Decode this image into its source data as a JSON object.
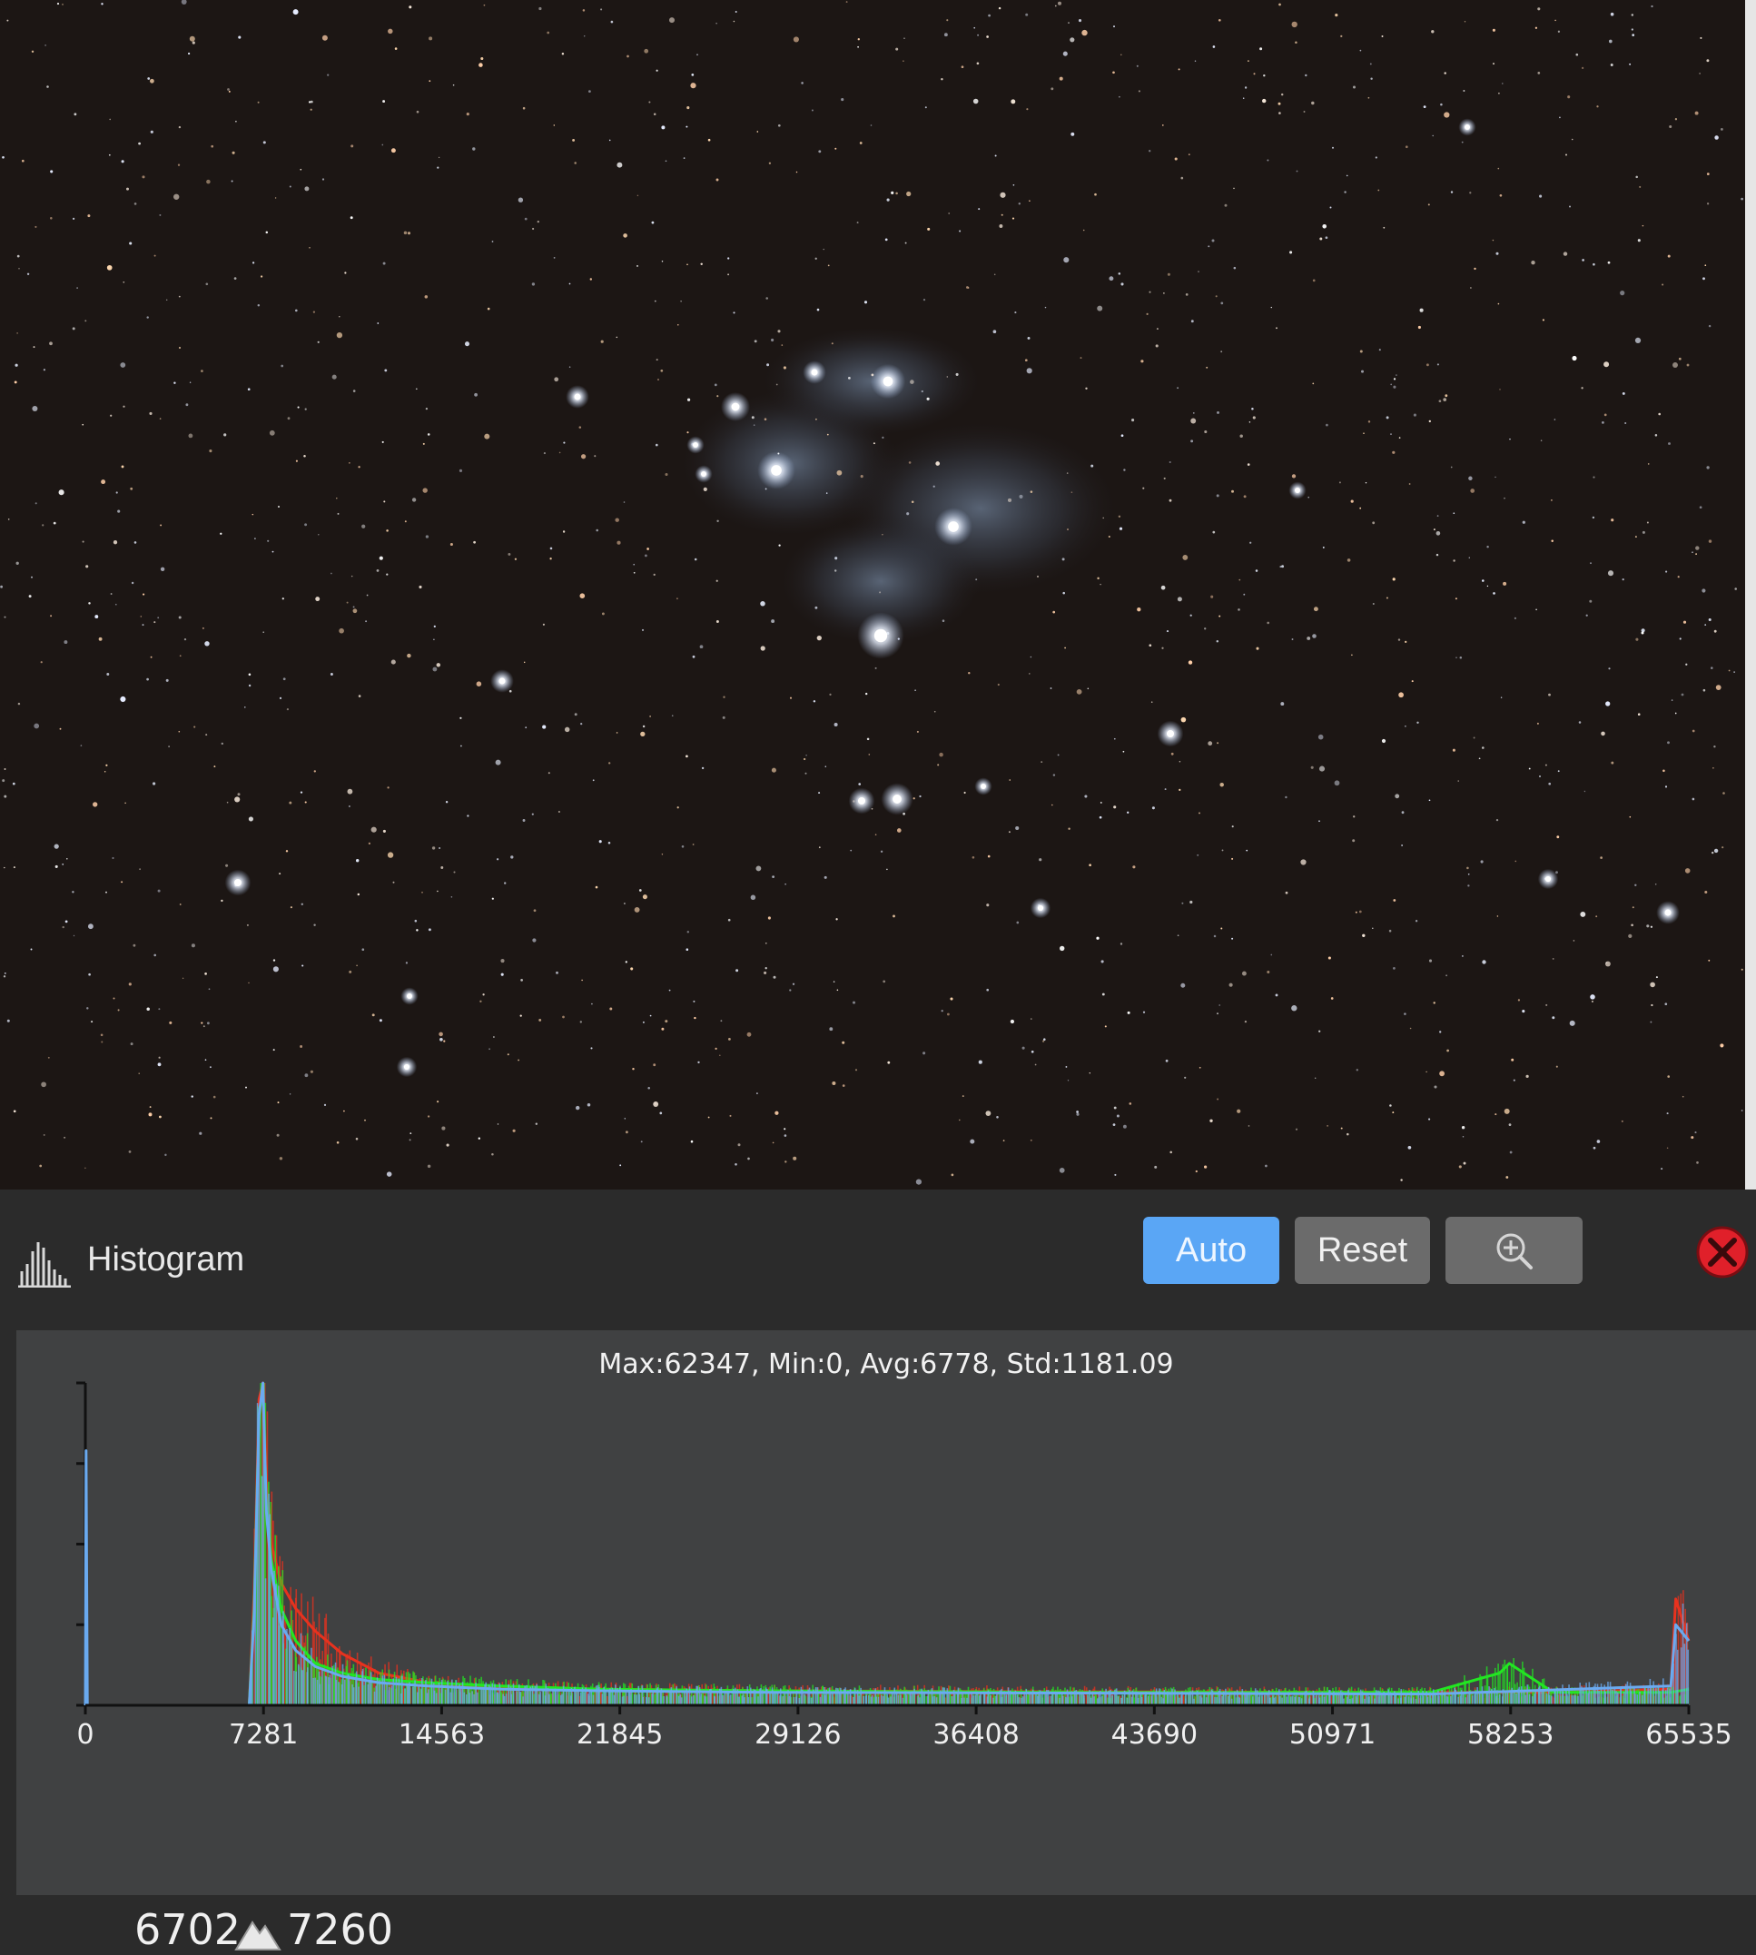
{
  "panel": {
    "title": "Histogram",
    "icon": "histogram-icon",
    "buttons": {
      "auto_label": "Auto",
      "reset_label": "Reset",
      "zoom_icon": "zoom-in-icon",
      "close_icon": "close-icon"
    },
    "colors": {
      "auto_active": "#5aa6f5",
      "button_inactive": "#6b6b6b",
      "close": "#e0202a",
      "red_channel": "#e8321e",
      "green_channel": "#22e622",
      "blue_channel": "#6aaaf0"
    }
  },
  "stats_text": "Max:62347, Min:0, Avg:6778, Std:1181.09",
  "range": {
    "low": "6702",
    "high": "7260",
    "icon": "mountain-icon"
  },
  "chart_data": {
    "type": "line",
    "x_ticks": [
      "0",
      "7281",
      "14563",
      "21845",
      "29126",
      "36408",
      "43690",
      "50971",
      "58253",
      "65535"
    ],
    "xlim": [
      0,
      65535
    ],
    "ylim": [
      0,
      1
    ],
    "grid": false,
    "series": [
      {
        "color": "#e8321e",
        "x": [
          0,
          6700,
          6900,
          7100,
          7260,
          7400,
          7600,
          8000,
          8600,
          9400,
          10500,
          12000,
          14000,
          17000,
          21000,
          28000,
          40000,
          55000,
          60000,
          64800,
          65000,
          65535
        ],
        "y": [
          0,
          0,
          0.35,
          0.95,
          1.0,
          0.7,
          0.5,
          0.38,
          0.3,
          0.23,
          0.16,
          0.1,
          0.07,
          0.055,
          0.05,
          0.045,
          0.042,
          0.04,
          0.04,
          0.05,
          0.33,
          0.2
        ]
      },
      {
        "color": "#22e622",
        "x": [
          0,
          6700,
          6900,
          7100,
          7260,
          7400,
          7600,
          8000,
          8600,
          9400,
          10500,
          12000,
          14000,
          17000,
          21000,
          28000,
          40000,
          55000,
          57800,
          58200,
          59000,
          60000,
          64800,
          65535
        ],
        "y": [
          0,
          0,
          0.3,
          0.9,
          0.98,
          0.62,
          0.45,
          0.3,
          0.2,
          0.13,
          0.1,
          0.08,
          0.07,
          0.06,
          0.05,
          0.045,
          0.04,
          0.04,
          0.1,
          0.13,
          0.09,
          0.04,
          0.04,
          0.05
        ]
      },
      {
        "color": "#6aaaf0",
        "x": [
          0,
          30,
          80,
          6700,
          6900,
          7100,
          7260,
          7400,
          7600,
          8000,
          8600,
          9400,
          10500,
          12000,
          14000,
          17000,
          21000,
          28000,
          40000,
          55000,
          64800,
          65000,
          65535
        ],
        "y": [
          0,
          0.79,
          0,
          0,
          0.28,
          0.9,
          1.0,
          0.6,
          0.42,
          0.25,
          0.17,
          0.12,
          0.09,
          0.07,
          0.06,
          0.05,
          0.045,
          0.04,
          0.038,
          0.035,
          0.06,
          0.25,
          0.2
        ]
      }
    ]
  }
}
